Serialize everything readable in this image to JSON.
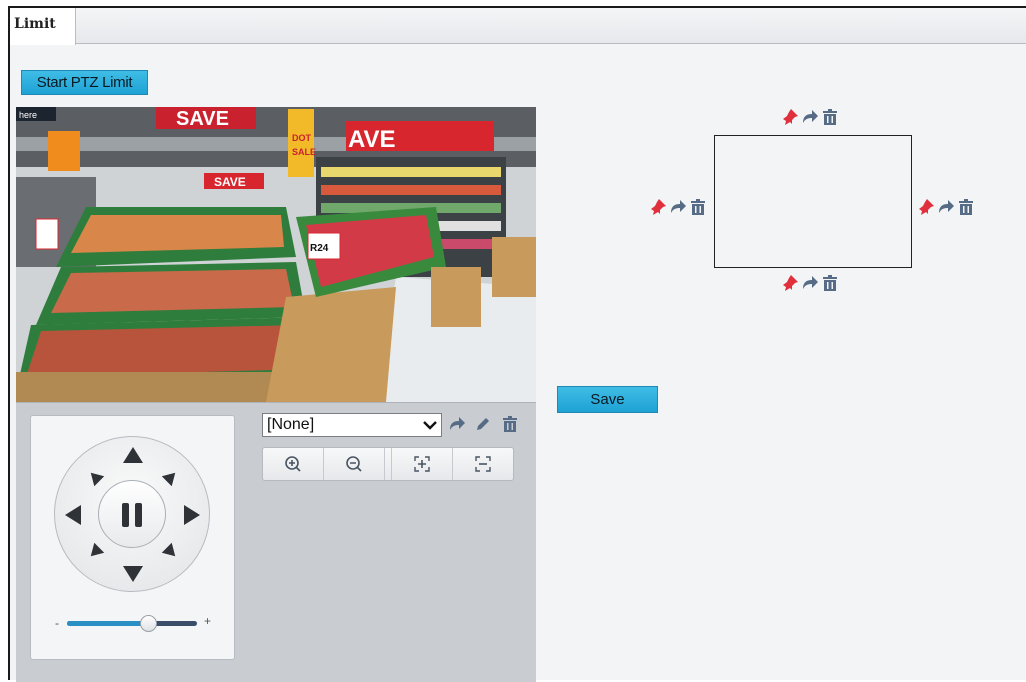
{
  "tabs": [
    {
      "label": "Limit"
    }
  ],
  "toolbar": {
    "start_label": "Start PTZ Limit",
    "save_label": "Save"
  },
  "video": {
    "overlay_tag": "here",
    "signs": [
      "SAVE",
      "AVE",
      "SAVE",
      "SALE",
      "R24",
      "DOT"
    ]
  },
  "ptz": {
    "speed_min_label": "-",
    "speed_max_label": "+",
    "speed_level": 0.62,
    "preset": {
      "selected": "[None]"
    }
  },
  "limit_edges": [
    "top",
    "bottom",
    "left",
    "right"
  ],
  "colors": {
    "accent": "#1ea1d4",
    "pin": "#e0303c",
    "icon": "#566b85"
  }
}
